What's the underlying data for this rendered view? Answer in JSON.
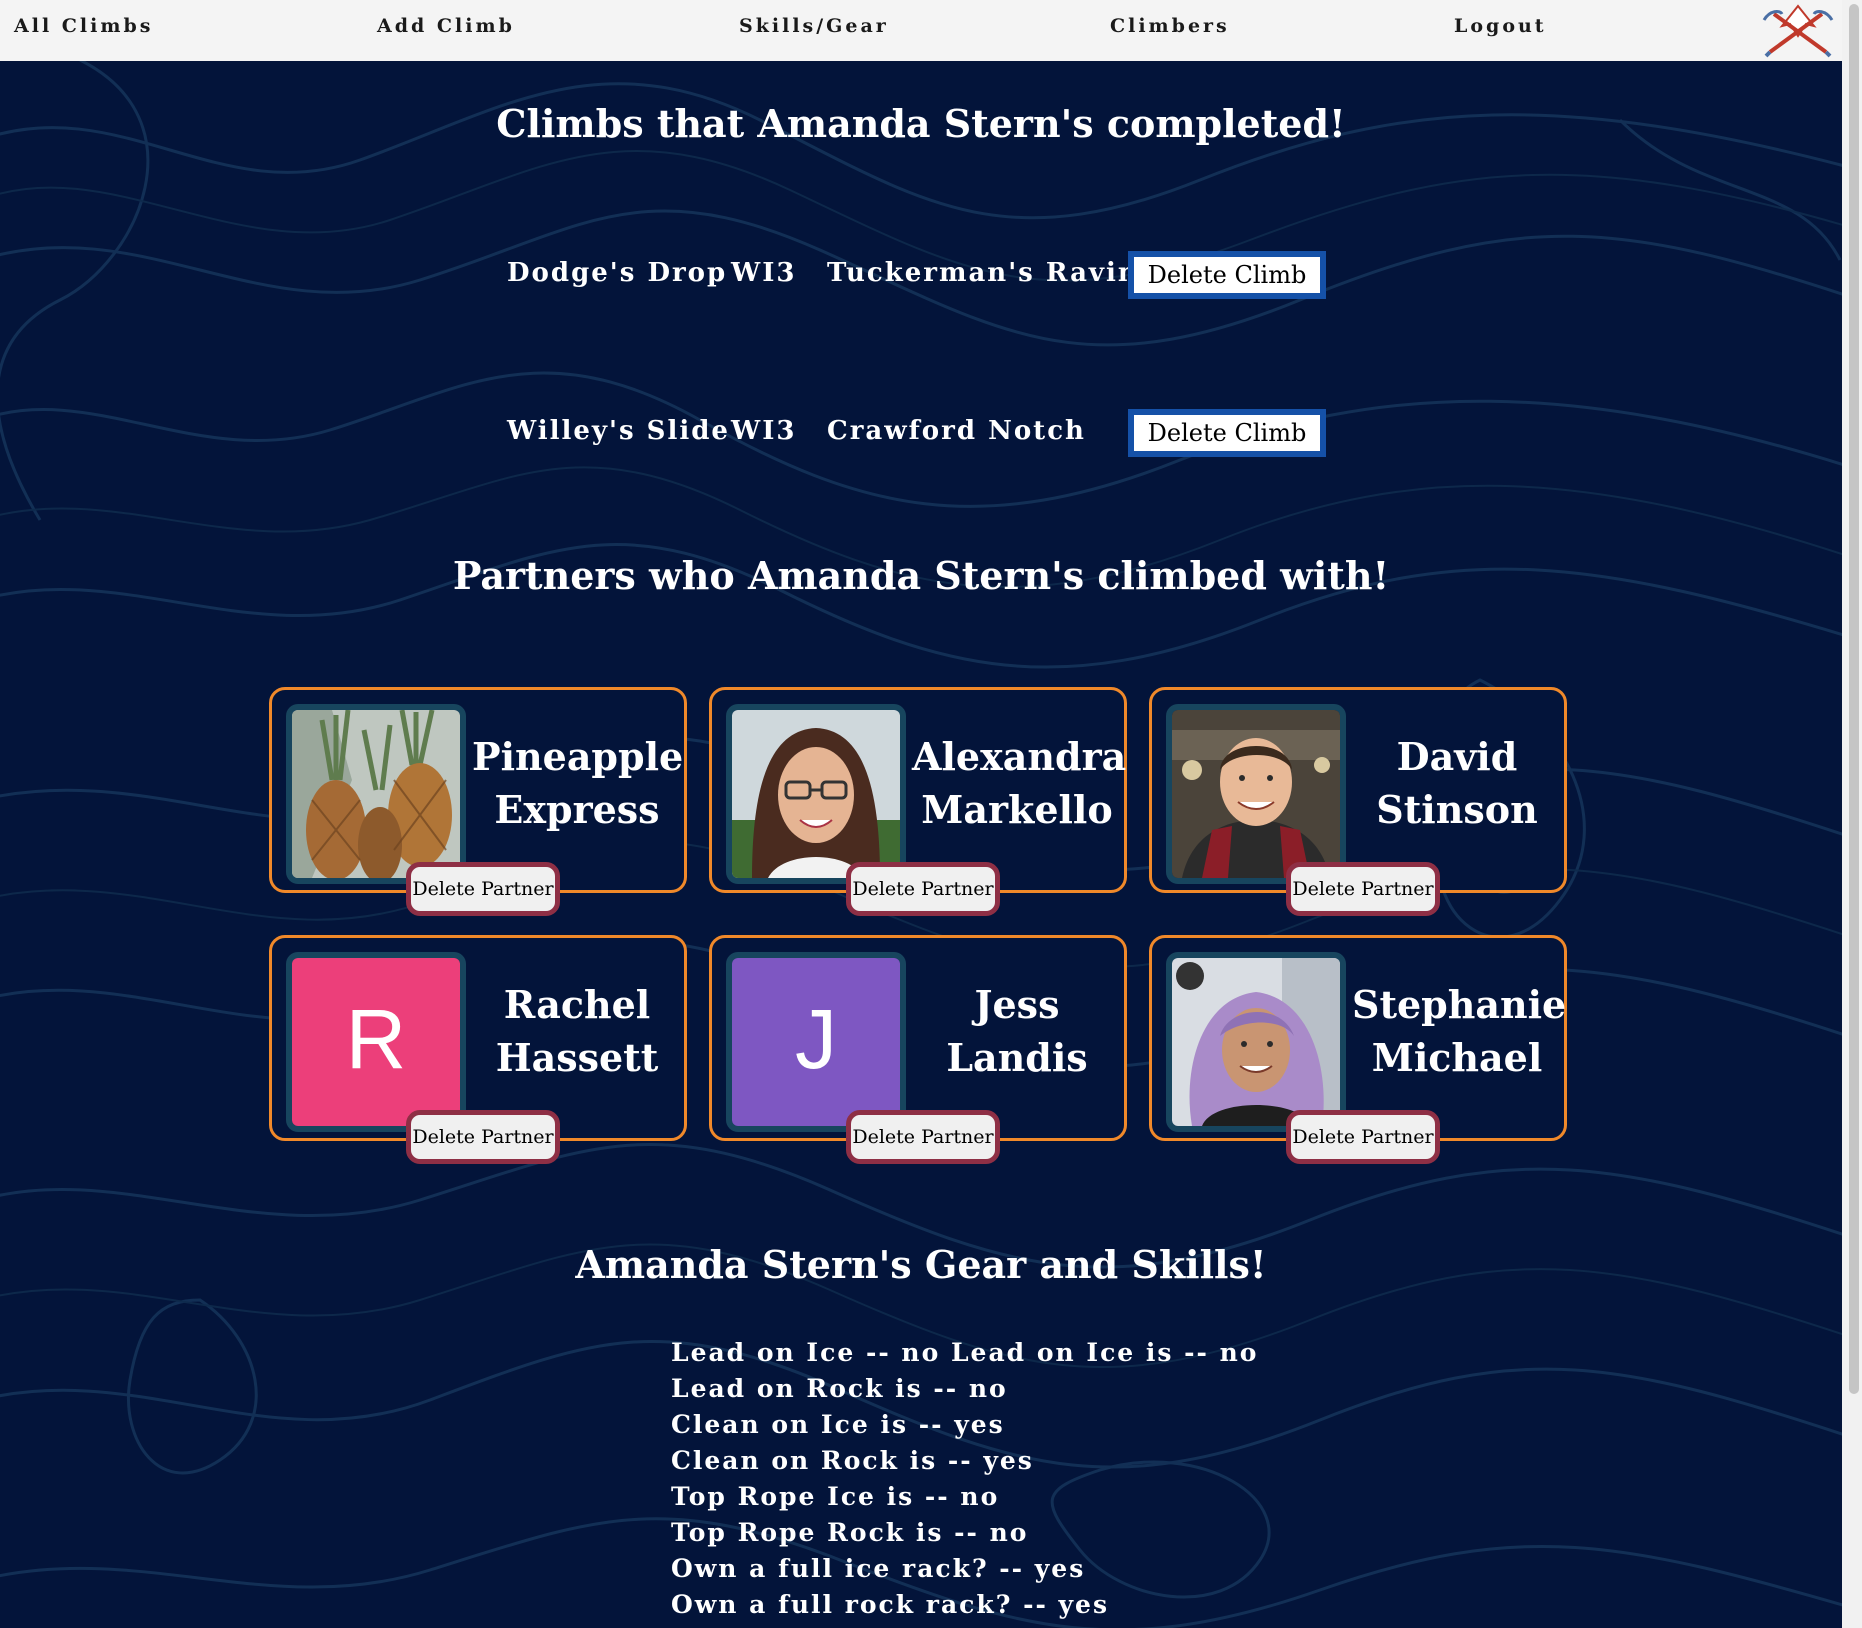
{
  "navbar": {
    "links": [
      "All Climbs",
      "Add Climb",
      "Skills/Gear",
      "Climbers",
      "Logout"
    ],
    "logo_icon": "crossed-ice-axes-icon"
  },
  "climbs_section": {
    "title": "Climbs that Amanda Stern's completed!",
    "delete_label": "Delete Climb",
    "climbs": [
      {
        "name": "Dodge's Drop",
        "grade": "WI3",
        "area": "Tuckerman's Ravine"
      },
      {
        "name": "Willey's Slide",
        "grade": "WI3",
        "area": "Crawford Notch"
      }
    ]
  },
  "partners_section": {
    "title": "Partners who Amanda Stern's climbed with!",
    "delete_label": "Delete Partner",
    "partners": [
      {
        "first": "Pineapple",
        "last": "Express",
        "avatar": "pineapple-photo"
      },
      {
        "first": "Alexandra",
        "last": "Markello",
        "avatar": "portrait-photo"
      },
      {
        "first": "David",
        "last": "Stinson",
        "avatar": "portrait-photo"
      },
      {
        "first": "Rachel",
        "last": "Hassett",
        "avatar": "letter",
        "initial": "R",
        "color": "#ec3f7a"
      },
      {
        "first": "Jess",
        "last": "Landis",
        "avatar": "letter",
        "initial": "J",
        "color": "#7e57c2"
      },
      {
        "first": "Stephanie",
        "last": "Michael",
        "avatar": "portrait-photo"
      }
    ]
  },
  "skills_section": {
    "title": "Amanda Stern's Gear and Skills!",
    "lines": [
      "Lead on Ice -- no Lead on Ice is -- no",
      "Lead on Rock is -- no",
      "Clean on Ice is -- yes",
      "Clean on Rock is -- yes",
      "Top Rope Ice is -- no",
      "Top Rope Rock is -- no",
      "Own a full ice rack? -- yes",
      "Own a full rock rack? -- yes"
    ]
  },
  "colors": {
    "background": "#03143a",
    "card_border": "#f0892a",
    "climb_button_border": "#1551a8",
    "partner_button_border": "#8e2f45"
  }
}
